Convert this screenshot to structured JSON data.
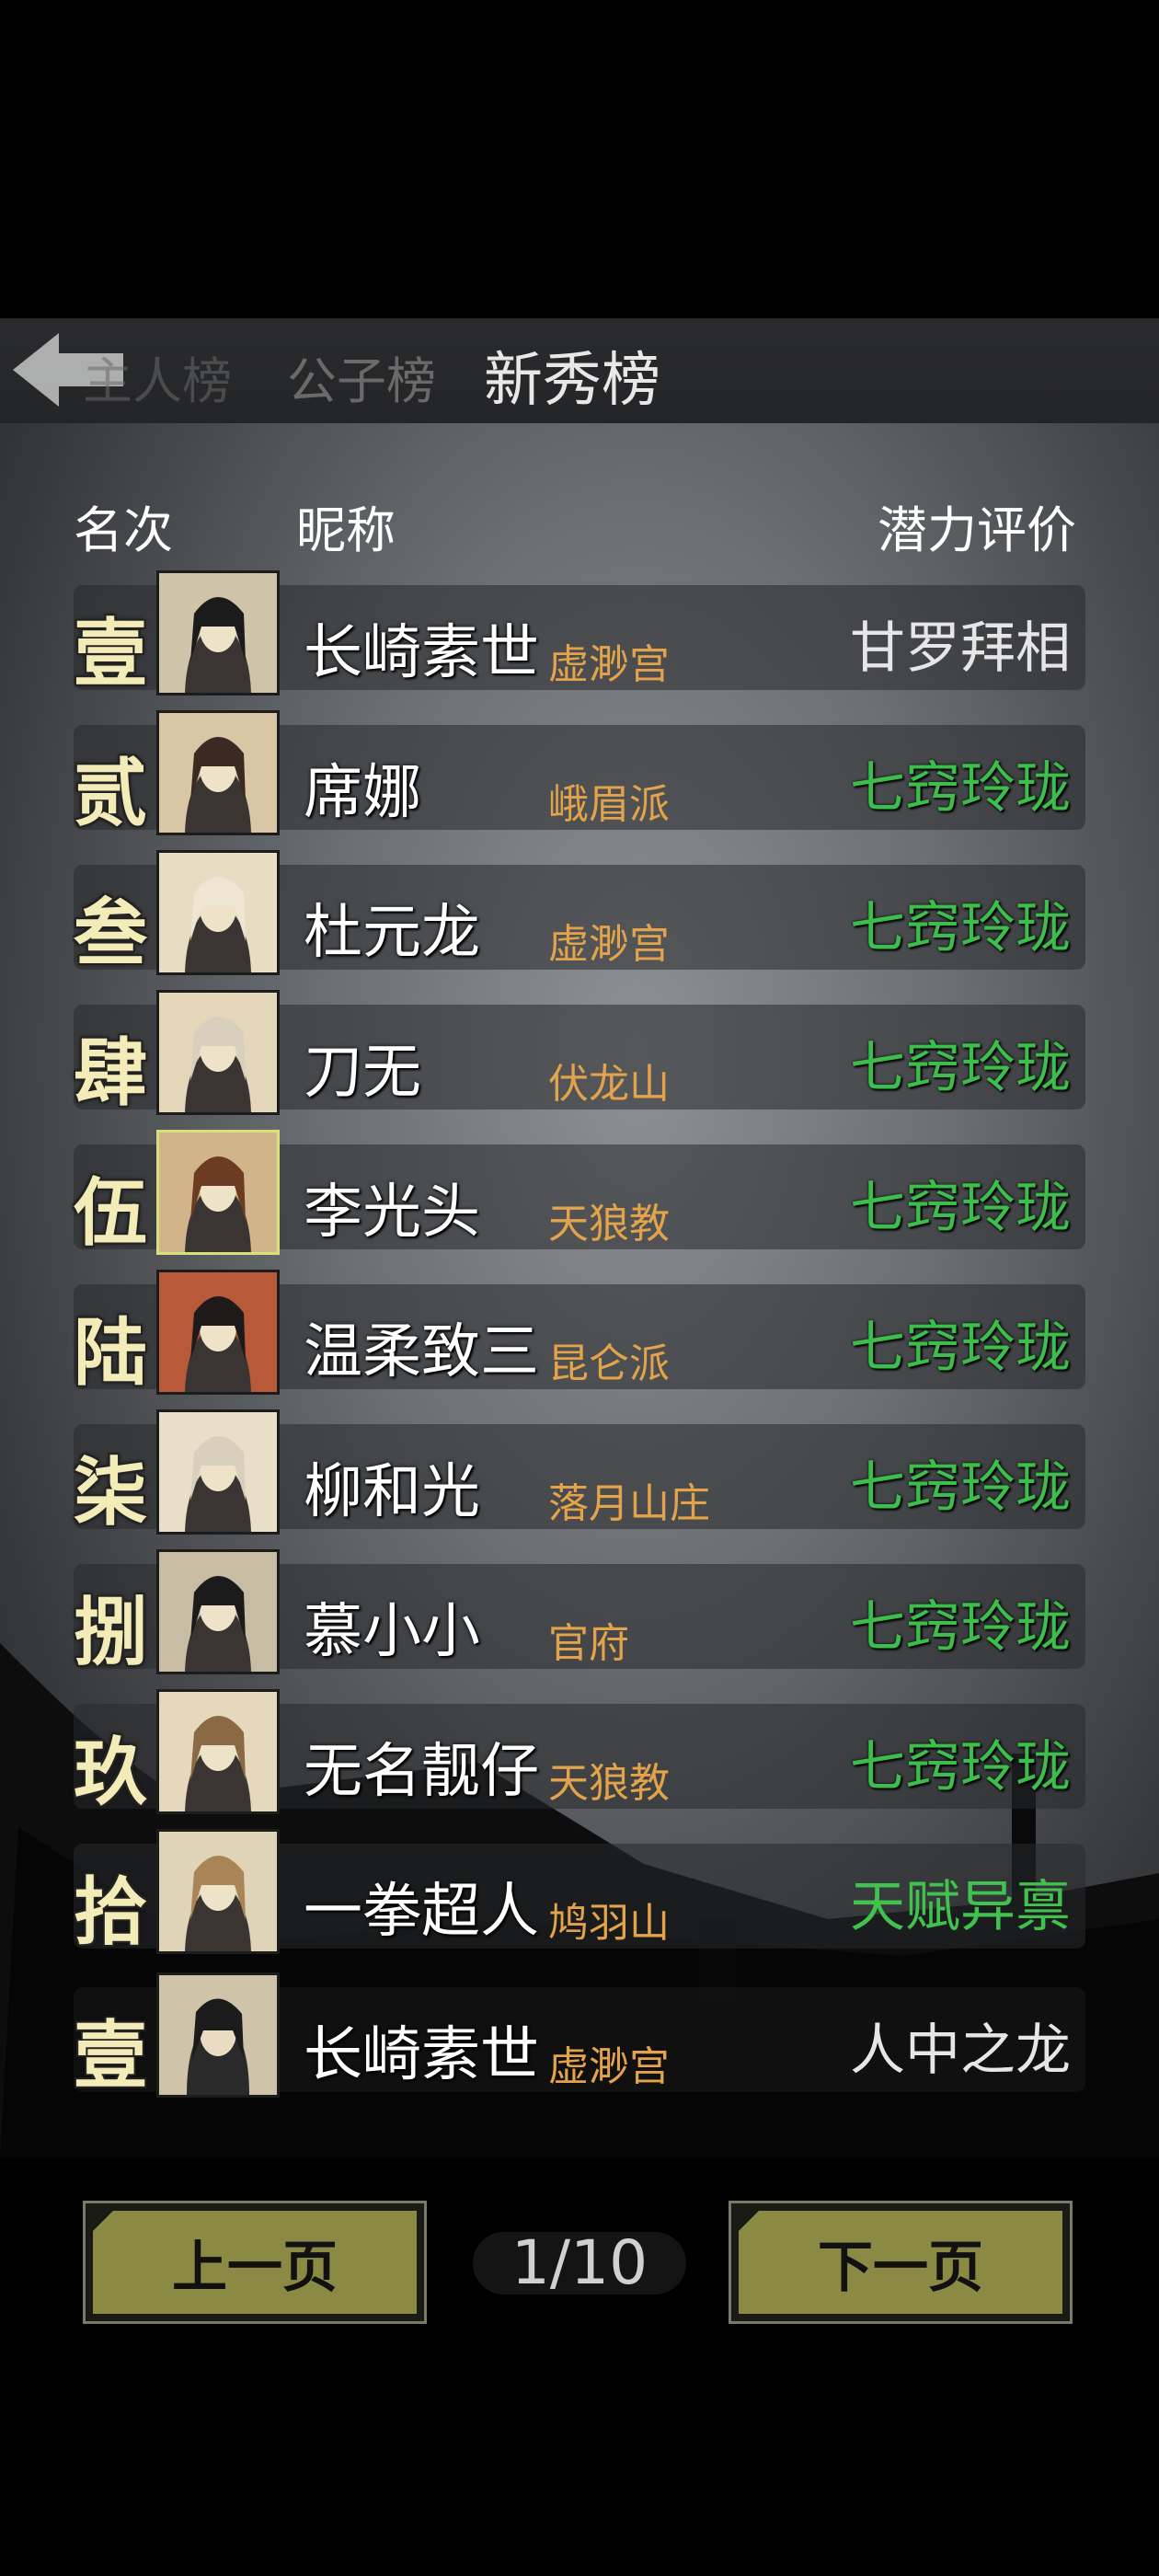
{
  "tabs": [
    {
      "label": "主人榜"
    },
    {
      "label": "公子榜"
    },
    {
      "label": "新秀榜"
    }
  ],
  "headers": {
    "rank": "名次",
    "nick": "昵称",
    "rating": "潜力评价"
  },
  "rows": [
    {
      "rank": "壹",
      "nick": "长崎素世",
      "sect": "虚渺宫",
      "rating": "甘罗拜相"
    },
    {
      "rank": "贰",
      "nick": "席娜",
      "sect": "峨眉派",
      "rating": "七窍玲珑"
    },
    {
      "rank": "叁",
      "nick": "杜元龙",
      "sect": "虚渺宫",
      "rating": "七窍玲珑"
    },
    {
      "rank": "肆",
      "nick": "刀无",
      "sect": "伏龙山",
      "rating": "七窍玲珑"
    },
    {
      "rank": "伍",
      "nick": "李光头",
      "sect": "天狼教",
      "rating": "七窍玲珑"
    },
    {
      "rank": "陆",
      "nick": "温柔致三",
      "sect": "昆仑派",
      "rating": "七窍玲珑"
    },
    {
      "rank": "柒",
      "nick": "柳和光",
      "sect": "落月山庄",
      "rating": "七窍玲珑"
    },
    {
      "rank": "捌",
      "nick": "慕小小",
      "sect": "官府",
      "rating": "七窍玲珑"
    },
    {
      "rank": "玖",
      "nick": "无名靓仔",
      "sect": "天狼教",
      "rating": "七窍玲珑"
    },
    {
      "rank": "拾",
      "nick": "一拳超人",
      "sect": "鸠羽山",
      "rating": "天赋异禀"
    }
  ],
  "self_row": {
    "rank": "壹",
    "nick": "长崎素世",
    "sect": "虚渺宫",
    "rating": "人中之龙"
  },
  "pagination": {
    "prev": "上一页",
    "page": "1/10",
    "next": "下一页"
  },
  "colors": {
    "sect": "#e3a34a",
    "rating_green": "#3cbd4c",
    "button": "#8b8a45",
    "rank": "#f3ecb8"
  }
}
